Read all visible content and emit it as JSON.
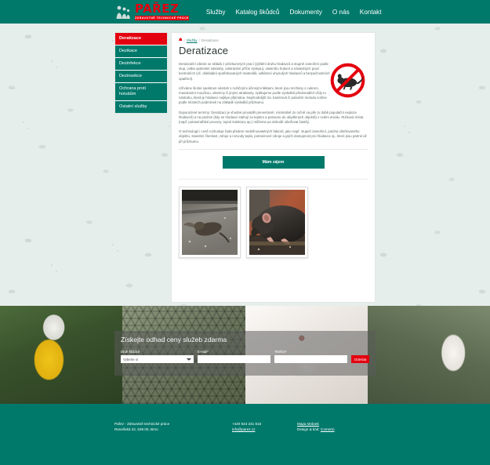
{
  "header": {
    "logo": {
      "word": "PAŘEZ",
      "subtitle": "ZDRAVOTNĚ TECHNICKÉ PRÁCE"
    },
    "nav": [
      {
        "label": "Služby"
      },
      {
        "label": "Katalog škůdců"
      },
      {
        "label": "Dokumenty"
      },
      {
        "label": "O nás"
      },
      {
        "label": "Kontakt"
      }
    ]
  },
  "sidebar": {
    "items": [
      {
        "label": "Deratizace",
        "active": true
      },
      {
        "label": "Dezikace",
        "active": false
      },
      {
        "label": "Dezinfekce",
        "active": false
      },
      {
        "label": "Dezinsekce",
        "active": false
      },
      {
        "label": "Ochrana proti holubům",
        "active": false
      },
      {
        "label": "Ostatní služby",
        "active": false
      }
    ]
  },
  "breadcrumb": {
    "home_icon": "home-icon",
    "separator": "/",
    "parent": "Služby",
    "current": "Deratizace"
  },
  "main": {
    "title": "Deratizace",
    "badge_icon": "no-rodents-prohibition-icon",
    "paragraphs": [
      "Deratizační zákrok se skládá z průzkumných prací (zjištění druhu hlodavců a stupně zamoření podle stop, volba optimální nástrahy, odstranění příčin výskytu), vlastního hubení a následných prací kontrolních (vč. dokládání spotřebovaných materiálů, odklizení uhynulých hlodavců a bezpečnostních opatření).",
      "Užíváme široké spektrum nástrah s rozličnými účinnými látkami, které jsou míchány s cukrem, masokostní moučkou, vitamíny či jinými atraktanty. Aplikujeme podle výsledků předvnadění vždy tu nástrahu, která je hlodavci nejlépe přijímána. Nejvhodnější tzv. bariérová či pulsační metodu volíme podle místních podmínek na základě výsledků průzkumu.",
      "Doporučené termíny: Deratizaci je vhodné provádět preventivně, minimálně 2x ročně na jaře (v době populační exploze hlodavců) a na podzim (kdy se hlodavci stahují za teplem a potravou do obydlených objektů) v celém areálu. Riziková místa (např. potravinářské provozy, topné kolektory ap.) můžeme po dohodě ošetřovat častěji.",
      "O technologii i ceně rozhoduje řada předem nedefinovatelných faktorů, jako např. stupeň zamoření, poloha ošetřovaného objektu, stavební členitost, zdroje a rozvody tepla, potravinové zdroje a jejich dostupnost pro hlodavce aj., které jsou patrné až při průzkumu."
    ],
    "cta_label": "Mám zájem",
    "gallery": [
      {
        "alt": "Uhynulý hlodavec na betonové podlaze",
        "caption": ""
      },
      {
        "alt": "Detail potkana u zdi",
        "caption": ""
      }
    ]
  },
  "hero": {
    "heading": "Získejte odhad ceny služeb zdarma",
    "fields": {
      "pest_label": "Druh škůdce",
      "pest_value": "Vyberte si",
      "pest_options": [
        "Vyberte si"
      ],
      "email_label": "E-mail*",
      "email_value": "",
      "email_placeholder": "",
      "phone_label": "Telefon*",
      "phone_value": "",
      "phone_placeholder": ""
    },
    "submit_label": "Odeslat",
    "accent_color": "#e3000f"
  },
  "footer": {
    "company": "Pařez - Zdravotně technické práce",
    "address": "Renešská 22, 639 00, Brno",
    "phone": "+420 543 241 615",
    "email": "info@parez.cz",
    "sitemap_label": "Mapa stránek",
    "credit_prefix": "Design & kód: ",
    "credit_link": "Comerto"
  },
  "theme": {
    "teal": "#00796b",
    "red": "#e3000f",
    "page_bg": "#e6eeec"
  }
}
